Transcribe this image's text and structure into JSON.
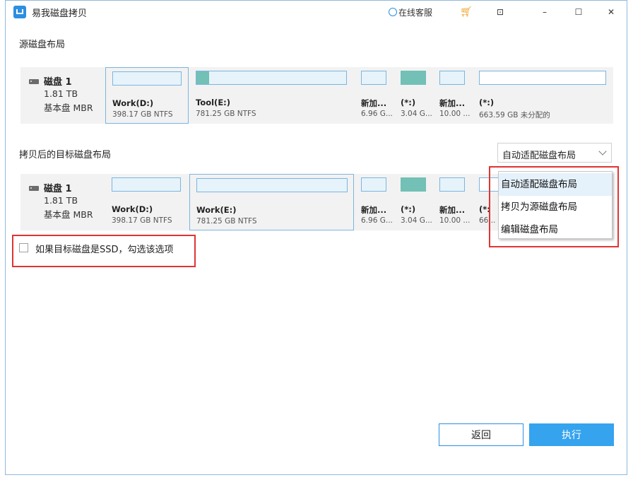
{
  "window": {
    "title": "易我磁盘拷贝"
  },
  "titlebar": {
    "service_label": "在线客服",
    "cart_icon": "cart-icon",
    "min_glyph": "–",
    "restore_glyph": "☐",
    "close_glyph": "✕",
    "feedback_glyph": "⊡",
    "accent": "#2c8fe0"
  },
  "source": {
    "label": "源磁盘布局",
    "disk": {
      "name": "磁盘 1",
      "size": "1.81 TB",
      "type": "基本盘 MBR"
    },
    "partitions": [
      {
        "name": "Work(D:)",
        "info": "398.17 GB NTFS"
      },
      {
        "name": "Tool(E:)",
        "info": "781.25 GB NTFS"
      },
      {
        "name": "新加...",
        "info": "6.96 G..."
      },
      {
        "name": "(*:)",
        "info": "3.04 G..."
      },
      {
        "name": "新加...",
        "info": "10.00 ..."
      },
      {
        "name": "(*:)",
        "info": "663.59 GB 未分配的"
      }
    ]
  },
  "target": {
    "label": "拷贝后的目标磁盘布局",
    "disk": {
      "name": "磁盘 1",
      "size": "1.81 TB",
      "type": "基本盘 MBR"
    },
    "partitions": [
      {
        "name": "Work(D:)",
        "info": "398.17 GB NTFS"
      },
      {
        "name": "Work(E:)",
        "info": "781.25 GB NTFS"
      },
      {
        "name": "新加...",
        "info": "6.96 G..."
      },
      {
        "name": "(*:)",
        "info": "3.04 G..."
      },
      {
        "name": "新加...",
        "info": "10.00 ..."
      },
      {
        "name": "(*:",
        "info": "66..."
      }
    ]
  },
  "layout_select": {
    "value": "自动适配磁盘布局",
    "options": [
      "自动适配磁盘布局",
      "拷贝为源磁盘布局",
      "编辑磁盘布局"
    ]
  },
  "ssd_option": {
    "label": "如果目标磁盘是SSD，勾选该选项",
    "checked": false
  },
  "buttons": {
    "back": "返回",
    "execute": "执行"
  }
}
